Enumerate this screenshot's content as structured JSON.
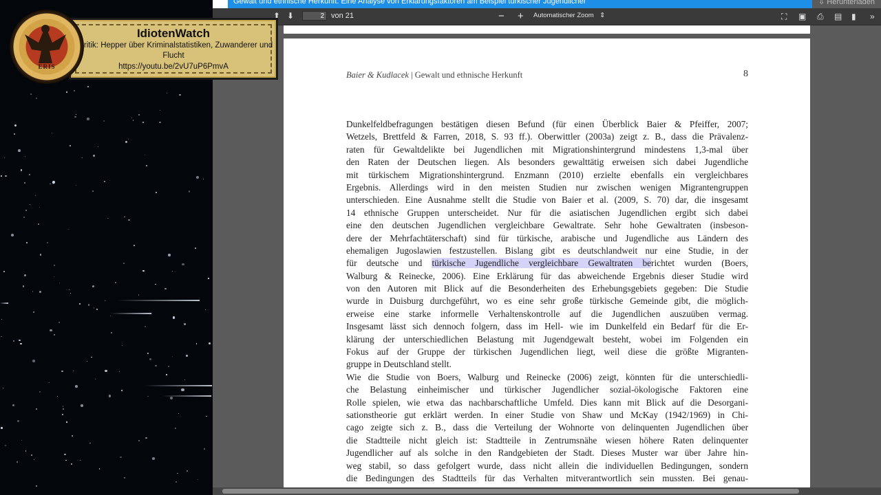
{
  "overlay": {
    "channel": "IdiotenWatch",
    "subtitle": "#Kritik: Hepper über Kriminalstatistiken, Zuwanderer und Flucht",
    "url": "https://youtu.be/2vU7uP6PmvA",
    "seal_text": "ERIS"
  },
  "viewer": {
    "tab_title": "Gewalt und ethnische Herkunft: Eine Analyse von Erklärungsfaktoren am Beispiel türkischer Jugendlicher",
    "download_label": "Herunterladen",
    "page_current": "2",
    "page_total": "von 21",
    "zoom_label": "Automatischer Zoom",
    "zoom_minus": "−",
    "zoom_plus": "+"
  },
  "document": {
    "running_head_authors": "Baier & Kudlacek",
    "running_head_title": " | Gewalt und ethnische Herkunft",
    "page_number": "8",
    "lines": [
      {
        "pre": "Dunkelfeldbefragungen bestätigen diesen Befund (für einen Überblick Baier & Pfeiffer, 2007;",
        "hl": "",
        "post": ""
      },
      {
        "pre": "Wetzels, Brettfeld & Farren, 2018, S. 93 ff.). Oberwittler (2003a) zeigt z. B., dass die Prävalenz-",
        "hl": "",
        "post": ""
      },
      {
        "pre": "raten für Gewaltdelikte bei Jugendlichen mit Migrationshintergrund mindestens 1,3-mal über",
        "hl": "",
        "post": ""
      },
      {
        "pre": "den Raten der Deutschen liegen. Als besonders gewalttätig erweisen sich dabei Jugendliche",
        "hl": "",
        "post": ""
      },
      {
        "pre": "mit türkischem Migrationshintergrund. Enzmann (2010) erzielte ebenfalls ein vergleichbares",
        "hl": "",
        "post": ""
      },
      {
        "pre": "Ergebnis. Allerdings wird in den meisten Studien nur zwischen wenigen Migrantengruppen",
        "hl": "",
        "post": ""
      },
      {
        "pre": "unterschieden. Eine Ausnahme stellt die Studie von Baier et al. (2009, S. 70) dar, die insgesamt",
        "hl": "",
        "post": ""
      },
      {
        "pre": "14 ethnische Gruppen unterscheidet. Nur für die asiatischen Jugendlichen ergibt sich dabei",
        "hl": "",
        "post": ""
      },
      {
        "pre": "eine den deutschen Jugendlichen vergleichbare Gewaltrate. Sehr hohe Gewaltraten (insbeson-",
        "hl": "",
        "post": ""
      },
      {
        "pre": "dere der Mehrfachtäterschaft) sind für türkische, arabische und Jugendliche aus Ländern des",
        "hl": "",
        "post": ""
      },
      {
        "pre": "ehemaligen Jugoslawien festzustellen. Bislang gibt es deutschlandweit nur eine Studie, in der",
        "hl": "",
        "post": ""
      },
      {
        "pre": "für deutsche und ",
        "hl": "türkische Jugendliche vergleichbare Gewaltraten be",
        "post": "richtet wurden (Boers,"
      },
      {
        "pre": "Walburg & Reinecke, 2006). Eine Erklärung für das abweichende Ergebnis dieser Studie wird",
        "hl": "",
        "post": ""
      },
      {
        "pre": "von den Autoren mit Blick auf die Besonderheiten des Erhebungsgebiets gegeben: Die Studie",
        "hl": "",
        "post": ""
      },
      {
        "pre": "wurde in Duisburg durchgeführt, wo es eine sehr große türkische Gemeinde gibt, die möglich-",
        "hl": "",
        "post": ""
      },
      {
        "pre": "erweise eine starke informelle Verhaltenskontrolle auf die Jugendlichen auszuüben vermag.",
        "hl": "",
        "post": ""
      },
      {
        "pre": "Insgesamt lässt sich dennoch folgern, dass im Hell- wie im Dunkelfeld ein Bedarf für die Er-",
        "hl": "",
        "post": ""
      },
      {
        "pre": "klärung der unterschiedlichen Belastung mit Jugendgewalt besteht, wobei im Folgenden ein",
        "hl": "",
        "post": ""
      },
      {
        "pre": "Fokus auf der Gruppe der türkischen Jugendlichen liegt, weil diese die größte Migranten-",
        "hl": "",
        "post": ""
      },
      {
        "pre": "gruppe in Deutschland stellt.",
        "hl": "",
        "post": "",
        "last": true
      },
      {
        "pre": "Wie die Studie von Boers, Walburg und Reinecke (2006) zeigt, könnten für die unterschiedli-",
        "hl": "",
        "post": ""
      },
      {
        "pre": "che Belastung einheimischer und türkischer Jugendlicher sozial-ökologische Faktoren eine",
        "hl": "",
        "post": ""
      },
      {
        "pre": "Rolle spielen, wie etwa das nachbarschaftliche Umfeld. Dies kann mit Blick auf die Desorgani-",
        "hl": "",
        "post": ""
      },
      {
        "pre": "sationstheorie gut erklärt werden. In einer Studie von Shaw und McKay (1942/1969) in Chi-",
        "hl": "",
        "post": ""
      },
      {
        "pre": "cago zeigte sich z. B., dass die Verteilung der Wohnorte von delinquenten Jugendlichen über",
        "hl": "",
        "post": ""
      },
      {
        "pre": "die Stadtteile nicht gleich ist: Stadtteile in Zentrumsnähe wiesen höhere Raten delinquenter",
        "hl": "",
        "post": ""
      },
      {
        "pre": "Jugendlicher auf als solche in den Randgebieten der Stadt. Dieses Muster war über Jahre hin-",
        "hl": "",
        "post": ""
      },
      {
        "pre": "weg stabil, so dass gefolgert wurde, dass nicht allein die individuellen Bedingungen, sondern",
        "hl": "",
        "post": ""
      },
      {
        "pre": "die Bedingungen des Stadtteils für das Verhalten mitverantwortlich sein mussten. Bei genau-",
        "hl": "",
        "post": ""
      }
    ]
  },
  "colors": {
    "highlight": "#d5d3f7",
    "tab_bar": "#1d8fe6",
    "toolbar": "#3a3a3a"
  },
  "icons": [
    "back-arrow-icon",
    "prev-page-icon",
    "next-page-icon",
    "fullscreen-icon",
    "open-file-icon",
    "print-icon",
    "save-icon",
    "bookmark-icon",
    "tools-icon"
  ]
}
